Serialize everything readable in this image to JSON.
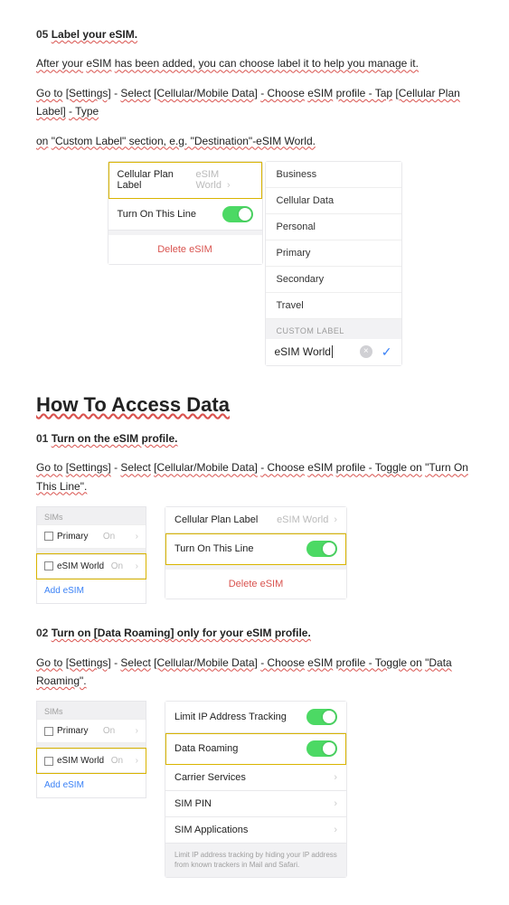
{
  "step05": {
    "num": "05",
    "title": "Label your eSIM.",
    "line1_a": "After your",
    "line1_b": "eSIM",
    "line1_c": "has been added, you can choose label it to help you manage it.",
    "line2_a": "Go to",
    "line2_settings": "[Settings]",
    "sep1": " - ",
    "line2_select": "Select",
    "line2_cell": "[Cellular/Mobile Data]",
    "line2_choose": " - Choose",
    "line2_esim": "eSIM",
    "line2_profile": "profile - Tap",
    "line2_plan": "[Cellular Plan Label]",
    "line2_type": " - Type",
    "line3_a": "on",
    "line3_b": "\"Custom Label\" section, e.g. \"Destination\"-eSIM World."
  },
  "panel05_left": {
    "row1_label": "Cellular Plan Label",
    "row1_value": "eSIM World",
    "row2_label": "Turn On This Line",
    "delete": "Delete eSIM"
  },
  "panel05_right": {
    "options": [
      "Business",
      "Cellular Data",
      "Personal",
      "Primary",
      "Secondary",
      "Travel"
    ],
    "section": "CUSTOM LABEL",
    "input_value": "eSIM World"
  },
  "header2": "How To Access Data",
  "step01": {
    "num": "01",
    "title": "Turn on the eSIM profile.",
    "a": "Go to",
    "settings": "[Settings]",
    "sep": " - ",
    "select": "Select",
    "cell": "[Cellular/Mobile Data]",
    "choose": " - Choose",
    "esim": "eSIM",
    "profile": "profile - Toggle on",
    "toggle": "\"Turn On This Line\"."
  },
  "sim_panel": {
    "hdr": "SIMs",
    "primary": "Primary",
    "on": "On",
    "world": "eSIM World",
    "add": "Add eSIM"
  },
  "panel01_right": {
    "row1_label": "Cellular Plan Label",
    "row1_value": "eSIM World",
    "row2_label": "Turn On This Line",
    "delete": "Delete eSIM"
  },
  "step02": {
    "num": "02",
    "title": "Turn on [Data Roaming] only for your eSIM profile.",
    "a": "Go to",
    "settings": "[Settings]",
    "sep": " - ",
    "select": "Select",
    "cell": "[Cellular/Mobile Data]",
    "choose": " - Choose",
    "esim": "eSIM",
    "profile": "profile - Toggle on",
    "toggle": "\"Data Roaming\"."
  },
  "panel02_right": {
    "r1": "Limit IP Address Tracking",
    "r2": "Data Roaming",
    "r3": "Carrier Services",
    "r4": "SIM PIN",
    "r5": "SIM Applications",
    "foot": "Limit IP address tracking by hiding your IP address from known trackers in Mail and Safari."
  }
}
